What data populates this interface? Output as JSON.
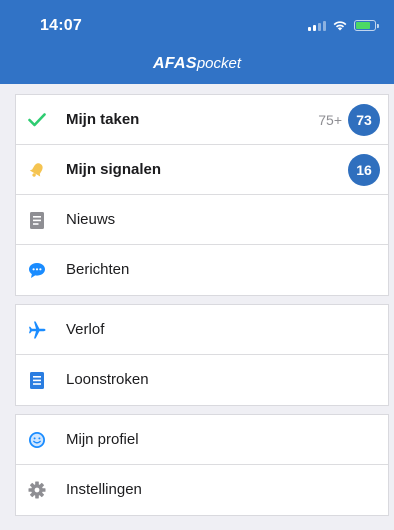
{
  "status_bar": {
    "time": "14:07",
    "battery_level": 0.8
  },
  "header": {
    "brand": "AFAS",
    "brand_sub": "pocket"
  },
  "colors": {
    "header": "#3173c6",
    "badge": "#2f6fbe",
    "check": "#2ecc71",
    "bell": "#f5c451",
    "icon_gray": "#8e8e93",
    "icon_blue": "#1a8cff"
  },
  "menu": {
    "section1": [
      {
        "label": "Mijn taken",
        "icon": "check-icon",
        "count": "75+",
        "badge": "73"
      },
      {
        "label": "Mijn signalen",
        "icon": "bell-icon",
        "badge": "16"
      },
      {
        "label": "Nieuws",
        "icon": "news-document-icon"
      },
      {
        "label": "Berichten",
        "icon": "chat-bubble-icon"
      }
    ],
    "section2": [
      {
        "label": "Verlof",
        "icon": "airplane-icon"
      },
      {
        "label": "Loonstroken",
        "icon": "payslip-document-icon"
      }
    ],
    "section3": [
      {
        "label": "Mijn profiel",
        "icon": "smiley-profile-icon"
      },
      {
        "label": "Instellingen",
        "icon": "gear-icon"
      }
    ]
  }
}
